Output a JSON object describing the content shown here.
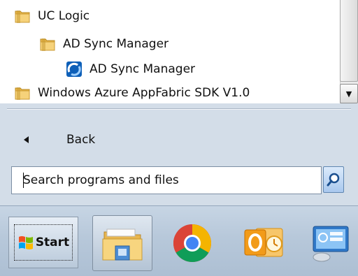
{
  "programs": {
    "items": [
      {
        "label": "UC Logic",
        "icon": "folder-icon"
      },
      {
        "label": "AD Sync Manager",
        "icon": "folder-icon"
      },
      {
        "label": "AD Sync Manager",
        "icon": "ad-sync-app-icon"
      },
      {
        "label": "Windows Azure AppFabric SDK V1.0",
        "icon": "folder-icon"
      }
    ]
  },
  "navigation": {
    "back_label": "Back"
  },
  "search": {
    "placeholder": "Search programs and files"
  },
  "taskbar": {
    "start_label": "Start",
    "pinned": [
      {
        "name": "windows-explorer",
        "icon": "file-explorer-icon"
      },
      {
        "name": "google-chrome",
        "icon": "chrome-icon"
      },
      {
        "name": "outlook",
        "icon": "outlook-icon"
      },
      {
        "name": "server-manager",
        "icon": "server-manager-icon"
      }
    ]
  }
}
